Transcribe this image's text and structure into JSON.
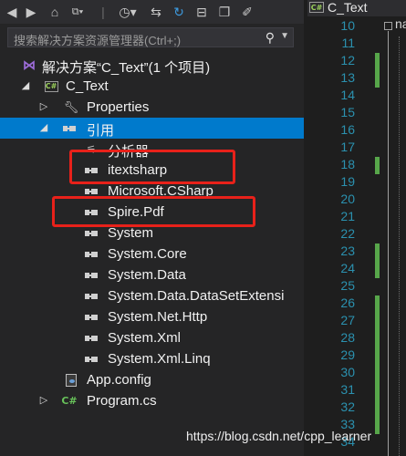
{
  "toolbar": {
    "buttons": [
      "back-icon",
      "forward-icon",
      "home-icon",
      "switch-views-dropdown-icon",
      "history-icon",
      "sync-icon",
      "refresh-icon",
      "collapse-all-icon",
      "properties-icon"
    ]
  },
  "search": {
    "placeholder": "搜索解决方案资源管理器(Ctrl+;)"
  },
  "tree": {
    "solution": "解决方案“C_Text”(1 个项目)",
    "project": "C_Text",
    "properties": "Properties",
    "references": "引用",
    "analyzers": "分析器",
    "refs": [
      "itextsharp",
      "Microsoft.CSharp",
      "Spire.Pdf",
      "System",
      "System.Core",
      "System.Data",
      "System.Data.DataSetExtensi",
      "System.Net.Http",
      "System.Xml",
      "System.Xml.Linq"
    ],
    "app_config": "App.config",
    "program_cs": "Program.cs"
  },
  "editor": {
    "tab_label": "C_Text",
    "code_fragment": "na",
    "line_numbers": [
      "10",
      "11",
      "12",
      "13",
      "14",
      "15",
      "16",
      "17",
      "18",
      "19",
      "20",
      "21",
      "22",
      "23",
      "24",
      "25",
      "26",
      "27",
      "28",
      "29",
      "30",
      "31",
      "32",
      "33",
      "34"
    ]
  },
  "watermark": "https://blog.csdn.net/cpp_learner"
}
